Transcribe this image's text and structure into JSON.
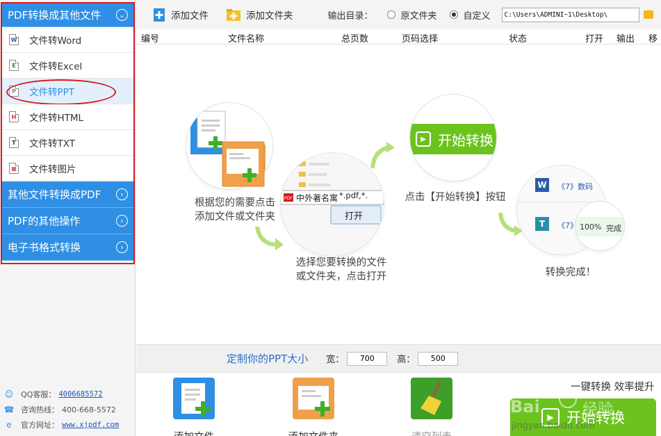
{
  "sidebar": {
    "sections": [
      {
        "label": "PDF转换成其他文件"
      },
      {
        "label": "其他文件转换成PDF"
      },
      {
        "label": "PDF的其他操作"
      },
      {
        "label": "电子书格式转换"
      }
    ],
    "items": [
      {
        "label": "文件转Word",
        "icon": "W",
        "color": "#2a5ca8"
      },
      {
        "label": "文件转Excel",
        "icon": "E",
        "color": "#2e8b3a"
      },
      {
        "label": "文件转PPT",
        "icon": "P",
        "color": "#888888"
      },
      {
        "label": "文件转HTML",
        "icon": "H",
        "color": "#c0392b"
      },
      {
        "label": "文件转TXT",
        "icon": "T",
        "color": "#333333"
      },
      {
        "label": "文件转图片",
        "icon": "▦",
        "color": "#c0392b"
      }
    ],
    "contact": {
      "qq_label": "QQ客服：",
      "qq_value": "4006685572",
      "hotline_label": "咨询热线：",
      "hotline_value": "400-668-5572",
      "site_label": "官方网址：",
      "site_value": "www.xjpdf.com"
    }
  },
  "toolbar": {
    "add_file": "添加文件",
    "add_folder": "添加文件夹",
    "output_label": "输出目录：",
    "radio_original": "原文件夹",
    "radio_custom": "自定义",
    "output_path": "C:\\Users\\ADMINI~1\\Desktop\\"
  },
  "table_headers": [
    "编号",
    "文件名称",
    "总页数",
    "页码选择",
    "状态",
    "打开",
    "输出",
    "移除"
  ],
  "illustration": {
    "step1": "根据您的需要点击\n添加文件或文件夹",
    "step2": "选择您要转换的文件\n或文件夹，点击打开",
    "step3": "点击【开始转换】按钮",
    "step4": "转换完成！",
    "dialog_file": "中外著名寓",
    "dialog_filter": "*.pdf,*.",
    "dialog_open": "打开",
    "start_label": "开始转换",
    "result_w": "《7》数码",
    "result_t": "《7》",
    "progress": "100%",
    "done": "完成"
  },
  "size_bar": {
    "title": "定制你的PPT大小",
    "width_label": "宽：",
    "width_value": "700",
    "height_label": "高：",
    "height_value": "500"
  },
  "actions": {
    "add_file": "添加文件",
    "add_folder": "添加文件夹",
    "clear": "清空列表",
    "slogan": "一键转换  效率提升",
    "start": "开始转换"
  },
  "watermark": {
    "brand": "Bai",
    "brand_cn": "经验",
    "url": "jingyan.baidu.com"
  },
  "colors": {
    "accent_blue": "#2f8fe4",
    "highlight_red": "#d71a21",
    "start_green": "#6cc31e"
  }
}
